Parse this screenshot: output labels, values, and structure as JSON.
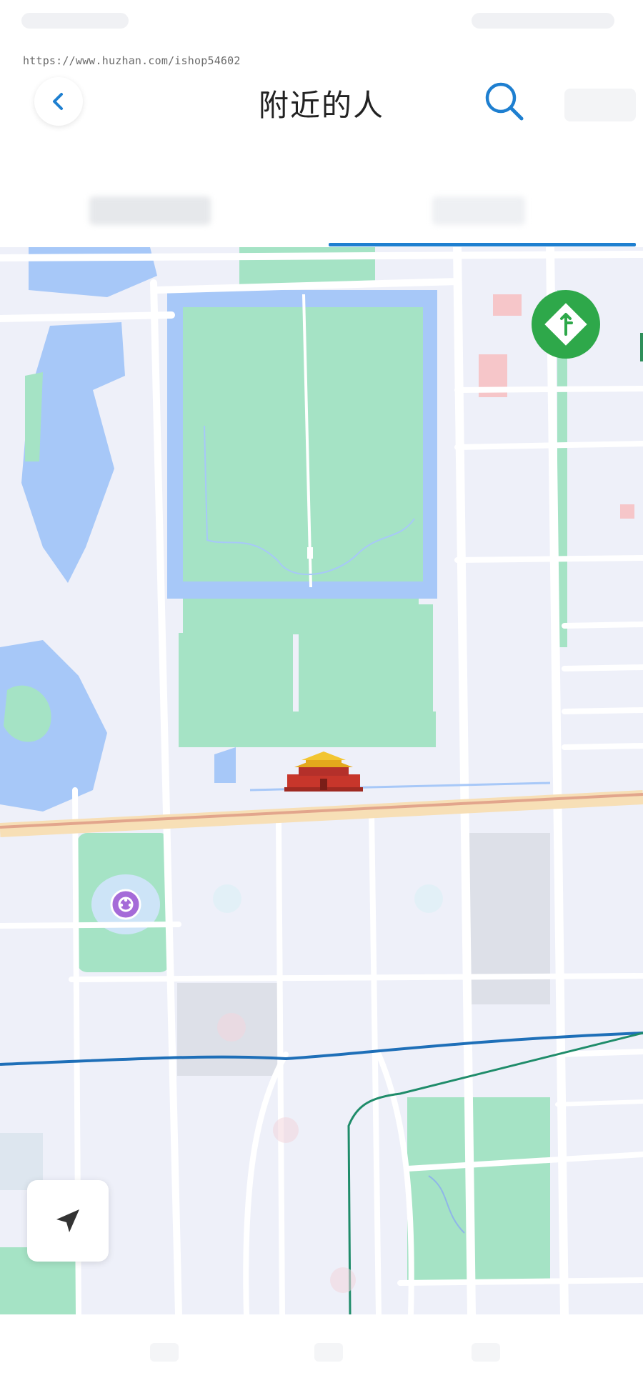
{
  "watermark": "https://www.huzhan.com/ishop54602",
  "header": {
    "title": "附近的人",
    "back_icon": "chevron-left-icon",
    "search_icon": "search-icon"
  },
  "tabs": {
    "active_index": 1
  },
  "map": {
    "compass_icon": "map-compass-icon",
    "locate_icon": "location-arrow-icon",
    "landmark_icon": "tiananmen-icon",
    "poi_icon": "cinema-poi-icon"
  },
  "colors": {
    "accent": "#1e7fd0",
    "park": "#a5e3c5",
    "water": "#a7c8f8",
    "road": "#ffffff",
    "land": "#eef0f9",
    "compass": "#2ea84a"
  }
}
